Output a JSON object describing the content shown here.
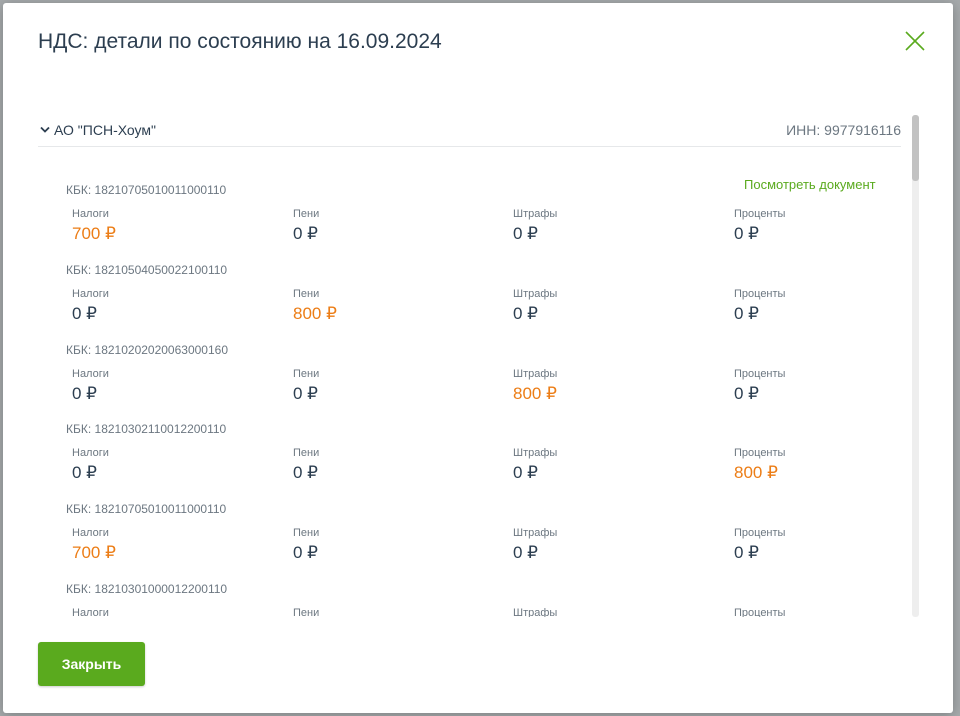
{
  "modal": {
    "title": "НДС: детали по состоянию на 16.09.2024",
    "close_label": "Закрыть"
  },
  "org": {
    "name": "АО \"ПСН-Хоум\"",
    "inn": "ИНН: 9977916116",
    "view_document": "Посмотреть документ"
  },
  "columns": [
    "Налоги",
    "Пени",
    "Штрафы",
    "Проценты"
  ],
  "kbk_items": [
    {
      "kbk": "КБК: 18210705010011000110",
      "values": [
        "700 ₽",
        "0 ₽",
        "0 ₽",
        "0 ₽"
      ],
      "highlight": [
        true,
        false,
        false,
        false
      ]
    },
    {
      "kbk": "КБК: 18210504050022100110",
      "values": [
        "0 ₽",
        "800 ₽",
        "0 ₽",
        "0 ₽"
      ],
      "highlight": [
        false,
        true,
        false,
        false
      ]
    },
    {
      "kbk": "КБК: 18210202020063000160",
      "values": [
        "0 ₽",
        "0 ₽",
        "800 ₽",
        "0 ₽"
      ],
      "highlight": [
        false,
        false,
        true,
        false
      ]
    },
    {
      "kbk": "КБК: 18210302110012200110",
      "values": [
        "0 ₽",
        "0 ₽",
        "0 ₽",
        "800 ₽"
      ],
      "highlight": [
        false,
        false,
        false,
        true
      ]
    },
    {
      "kbk": "КБК: 18210705010011000110",
      "values": [
        "700 ₽",
        "0 ₽",
        "0 ₽",
        "0 ₽"
      ],
      "highlight": [
        true,
        false,
        false,
        false
      ]
    },
    {
      "kbk": "КБК: 18210301000012200110",
      "values": [
        "",
        "",
        "",
        ""
      ],
      "highlight": [
        false,
        false,
        false,
        false
      ]
    }
  ],
  "colors": {
    "accent": "#5aaa1e",
    "highlight": "#ec7d16",
    "text": "#2c3e50",
    "muted": "#6c7781"
  },
  "icons": {
    "close": "close-icon",
    "chevron": "chevron-down-icon"
  }
}
